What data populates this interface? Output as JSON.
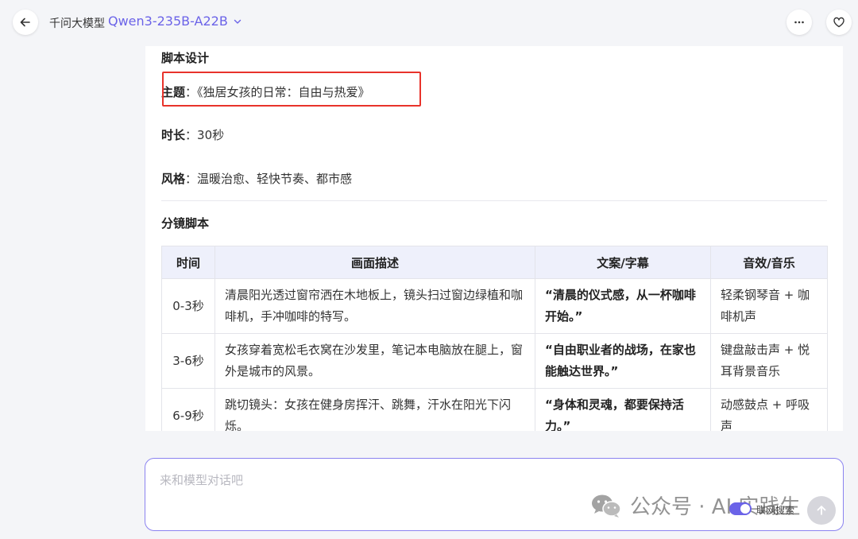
{
  "header": {
    "title": "千问大模型",
    "model_name": "Qwen3-235B-A22B",
    "accent": "#6b63e8",
    "icons": {
      "back": "arrow-left-icon",
      "more": "more-horizontal-icon",
      "favorite": "heart-icon",
      "dropdown": "chevron-down-icon"
    }
  },
  "content": {
    "section_title": "脚本设计",
    "fields": [
      {
        "label": "主题",
        "sep": "：",
        "value": "《独居女孩的日常：自由与热爱》"
      },
      {
        "label": "时长",
        "sep": "：",
        "value": "30秒"
      },
      {
        "label": "风格",
        "sep": "：",
        "value": "温暖治愈、轻快节奏、都市感"
      }
    ],
    "highlight_color": "#e8332b",
    "storyboard_title": "分镜脚本",
    "table": {
      "headers": [
        "时间",
        "画面描述",
        "文案/字幕",
        "音效/音乐"
      ],
      "rows": [
        {
          "time": "0-3秒",
          "scene": "清晨阳光透过窗帘洒在木地板上，镜头扫过窗边绿植和咖啡机，手冲咖啡的特写。",
          "copy": "“清晨的仪式感，从一杯咖啡开始。”",
          "sound": "轻柔钢琴音 + 咖啡机声"
        },
        {
          "time": "3-6秒",
          "scene": "女孩穿着宽松毛衣窝在沙发里，笔记本电脑放在腿上，窗外是城市的风景。",
          "copy": "“自由职业者的战场，在家也能触达世界。”",
          "sound": "键盘敲击声 + 悦耳背景音乐"
        },
        {
          "time": "6-9秒",
          "scene": "跳切镜头：女孩在健身房挥汗、跳舞，汗水在阳光下闪烁。",
          "copy": "“身体和灵魂，都要保持活力。”",
          "sound": "动感鼓点 + 呼吸声"
        }
      ]
    }
  },
  "input": {
    "placeholder": "来和模型对话吧",
    "web_search_label": "联网搜索",
    "web_search_on": true,
    "send_icon": "arrow-up-icon",
    "watermark_text": "公众号 · AI 实践生",
    "watermark_icon": "wechat-icon"
  }
}
